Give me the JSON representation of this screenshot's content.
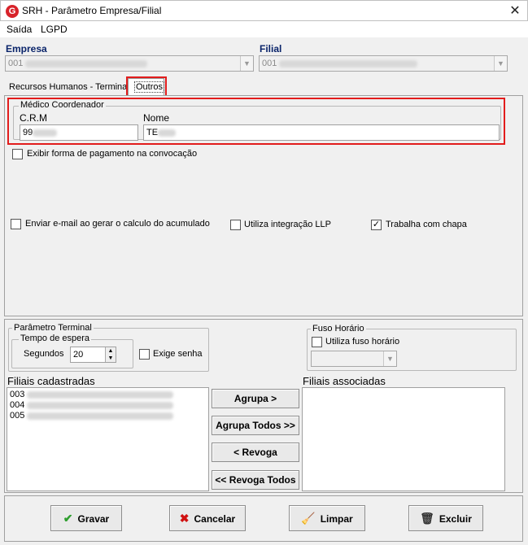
{
  "window": {
    "title": "SRH - Parâmetro Empresa/Filial",
    "app_icon": "G",
    "close": "✕"
  },
  "menu": {
    "items": [
      "Saída",
      "LGPD"
    ]
  },
  "empresa": {
    "label": "Empresa",
    "value": "001"
  },
  "filial": {
    "label": "Filial",
    "value": "001"
  },
  "tabs": [
    "Recursos Humanos - Terminal",
    "Outros"
  ],
  "medico": {
    "group_title": "Médico Coordenador",
    "crm_label": "C.R.M",
    "crm_value": "99",
    "nome_label": "Nome",
    "nome_value": "TE"
  },
  "checkboxes": {
    "exibir_pagamento": {
      "label": "Exibir forma de pagamento na convocação",
      "checked": false
    },
    "enviar_email": {
      "label": "Enviar e-mail ao gerar o calculo do acumulado",
      "checked": false
    },
    "integracao_llp": {
      "label": "Utiliza integração LLP",
      "checked": false
    },
    "trabalha_chapa": {
      "label": "Trabalha com chapa",
      "checked": true
    }
  },
  "terminal": {
    "group_title": "Parâmetro Terminal",
    "tempo_title": "Tempo de espera",
    "segundos_label": "Segundos",
    "segundos_value": "20",
    "exige_senha_label": "Exige senha"
  },
  "fuso": {
    "group_title": "Fuso Horário",
    "utiliza_label": "Utiliza fuso horário"
  },
  "filiais_cadastradas": {
    "label": "Filiais cadastradas",
    "items": [
      "003",
      "004",
      "005"
    ]
  },
  "filiais_associadas": {
    "label": "Filiais associadas"
  },
  "middle_buttons": {
    "agrupa": "Agrupa >",
    "agrupa_todos": "Agrupa Todos >>",
    "revoga": "< Revoga",
    "revoga_todos": "<< Revoga Todos"
  },
  "footer_buttons": {
    "gravar": "Gravar",
    "cancelar": "Cancelar",
    "limpar": "Limpar",
    "excluir": "Excluir"
  },
  "colors": {
    "highlight": "#e21c1c",
    "label_blue": "#0a246a",
    "check_green": "#2e9e2e",
    "cancel_red": "#d01010"
  }
}
